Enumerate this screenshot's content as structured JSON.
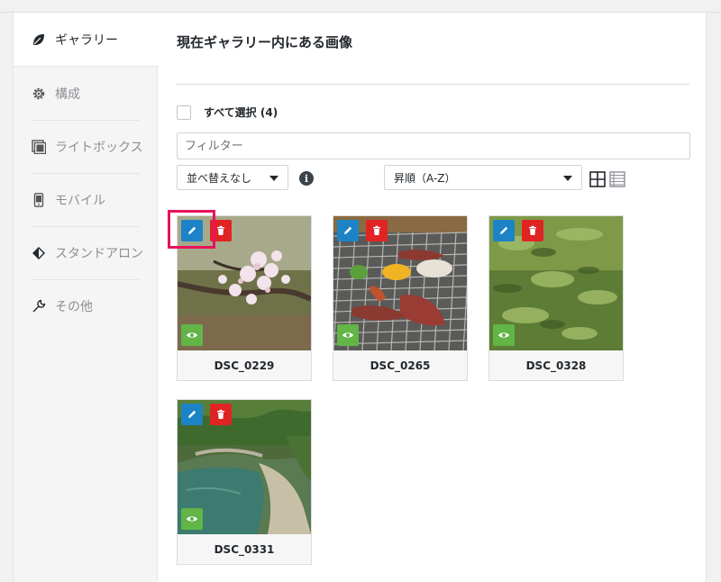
{
  "sidebar": {
    "items": [
      {
        "label": "ギャラリー",
        "icon": "leaf-icon",
        "active": true
      },
      {
        "label": "構成",
        "icon": "gear-icon",
        "active": false
      },
      {
        "label": "ライトボックス",
        "icon": "lightbox-icon",
        "active": false
      },
      {
        "label": "モバイル",
        "icon": "mobile-icon",
        "active": false
      },
      {
        "label": "スタンドアロン",
        "icon": "standalone-icon",
        "active": false
      },
      {
        "label": "その他",
        "icon": "wrench-icon",
        "active": false
      }
    ]
  },
  "main": {
    "title": "現在ギャラリー内にある画像",
    "select_all_label": "すべて選択 (4)",
    "filter_placeholder": "フィルター",
    "sort_select": "並べ替えなし",
    "order_select": "昇順（A-Z）",
    "info_glyph": "i"
  },
  "images": [
    {
      "name": "DSC_0229",
      "subject": "cherry-blossom"
    },
    {
      "name": "DSC_0265",
      "subject": "barbecue-grill"
    },
    {
      "name": "DSC_0328",
      "subject": "green-pond"
    },
    {
      "name": "DSC_0331",
      "subject": "mountain-river"
    }
  ],
  "colors": {
    "edit_button": "#1c84c6",
    "delete_button": "#e02424",
    "view_button": "#62b547",
    "highlight": "#e8125c"
  }
}
